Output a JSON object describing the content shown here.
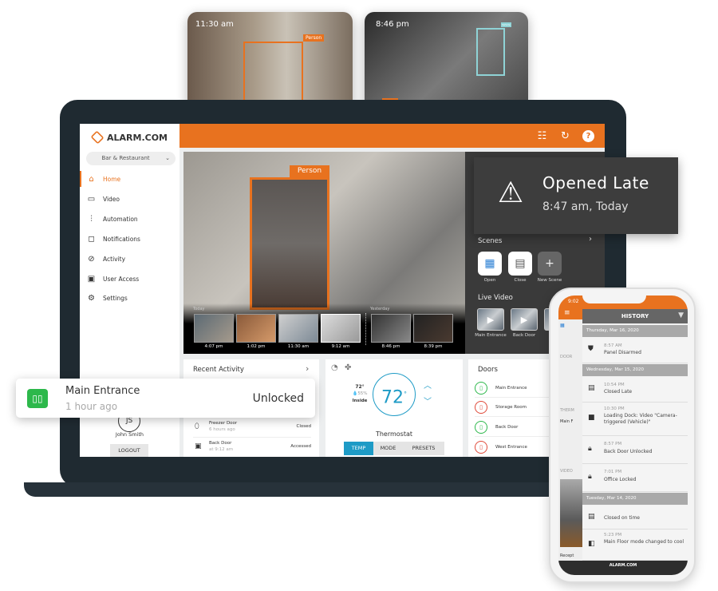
{
  "brand": {
    "name": "ALARM.COM",
    "accent": "#e8721f",
    "teal": "#1e9bc6"
  },
  "cameras": [
    {
      "time": "11:30 am",
      "detection": "Person"
    },
    {
      "time": "8:46 pm",
      "detection": "Vehicle"
    }
  ],
  "sidebar": {
    "location": "Bar & Restaurant",
    "items": [
      {
        "label": "Home",
        "icon": "home-icon",
        "active": true
      },
      {
        "label": "Video",
        "icon": "video-icon"
      },
      {
        "label": "Automation",
        "icon": "sliders-icon"
      },
      {
        "label": "Notifications",
        "icon": "notification-icon"
      },
      {
        "label": "Activity",
        "icon": "activity-icon"
      },
      {
        "label": "User Access",
        "icon": "user-access-icon"
      },
      {
        "label": "Settings",
        "icon": "gear-icon"
      }
    ],
    "user": {
      "initials": "JS",
      "name": "John Smith"
    },
    "logout": "LOGOUT"
  },
  "video": {
    "detection": "Person",
    "today_label": "Today",
    "yesterday_label": "Yesterday",
    "clips": [
      "4:07 pm",
      "1:02 pm",
      "11:30 am",
      "9:12 am",
      "8:46 pm",
      "8:39 pm"
    ]
  },
  "scenes": {
    "title": "Scenes",
    "items": [
      "Open",
      "Close",
      "New Scene"
    ]
  },
  "live_video": {
    "title": "Live Video",
    "items": [
      "Main Entrance",
      "Back Door",
      "E"
    ]
  },
  "alert": {
    "title": "Opened Late",
    "time": "8:47 am, Today"
  },
  "door_toast": {
    "name": "Main Entrance",
    "time": "1 hour ago",
    "status": "Unlocked"
  },
  "recent_activity": {
    "title": "Recent Activity",
    "items": [
      {
        "name": "Freezer Door",
        "time": "6 hours ago",
        "status": "Closed"
      },
      {
        "name": "Back Door",
        "time": "at 9:12 am",
        "status": "Accessed"
      }
    ]
  },
  "thermostat": {
    "inside_temp": "72°",
    "humidity": "55%",
    "inside_label": "Inside",
    "setpoint": "72",
    "degree": "°",
    "title": "Thermostat",
    "tabs": [
      "TEMP",
      "MODE",
      "PRESETS"
    ],
    "active_tab": "TEMP"
  },
  "doors": {
    "title": "Doors",
    "items": [
      {
        "name": "Main Entrance",
        "state": "unlocked",
        "color": "#2db84b"
      },
      {
        "name": "Storage Room",
        "state": "locked",
        "color": "#e04a3a"
      },
      {
        "name": "Back Door",
        "state": "unlocked",
        "color": "#2db84b"
      },
      {
        "name": "West Entrance",
        "state": "locked",
        "color": "#e04a3a"
      }
    ]
  },
  "phone": {
    "time": "9:02",
    "title": "HISTORY",
    "bg_labels": [
      "O",
      "DOOR",
      "THERM",
      "Main F",
      "VIDEO",
      "Recept"
    ],
    "days": [
      {
        "label": "Thursday, Mar 16, 2020",
        "events": [
          {
            "time": "8:57 AM",
            "text": "Panel Disarmed",
            "icon": "shield-icon"
          }
        ]
      },
      {
        "label": "Wednesday, Mar 15, 2020",
        "events": [
          {
            "time": "10:54 PM",
            "text": "Closed Late",
            "icon": "store-alert-icon"
          },
          {
            "time": "10:30 PM",
            "text": "Loading Dock: Video \"Camera-triggered (Vehicle)\"",
            "icon": "video-camera-icon"
          },
          {
            "time": "8:57 PM",
            "text": "Back Door Unlocked",
            "icon": "lock-icon"
          },
          {
            "time": "7:01 PM",
            "text": "Office Locked",
            "icon": "lock-icon"
          }
        ]
      },
      {
        "label": "Tuesday, Mar 14, 2020",
        "events": [
          {
            "time": "",
            "text": "Closed on time",
            "icon": "store-icon"
          },
          {
            "time": "5:23 PM",
            "text": "Main Floor mode changed to cool",
            "icon": "thermostat-icon"
          }
        ]
      }
    ],
    "footer": "ALARM.COM"
  }
}
